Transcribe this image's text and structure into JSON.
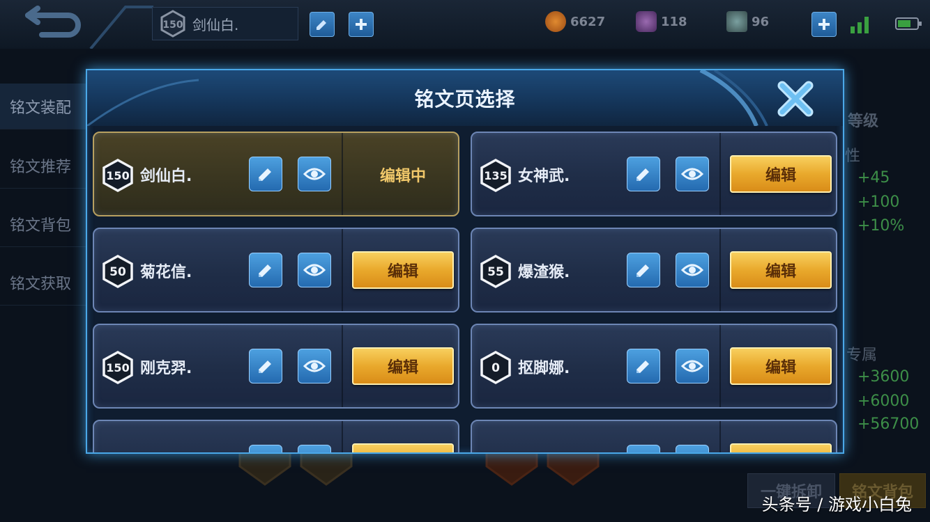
{
  "topbar": {
    "page_level": "150",
    "page_name": "剑仙白.",
    "gold": "6627",
    "diamonds": "118",
    "coupons": "96"
  },
  "side_menu": [
    {
      "label": "铭文装配"
    },
    {
      "label": "铭文推荐"
    },
    {
      "label": "铭文背包"
    },
    {
      "label": "铭文获取"
    }
  ],
  "right_panel": {
    "level_label": "等级",
    "attr_label": "性",
    "attr_values": [
      "+45",
      "+100",
      "+10%"
    ],
    "exclusive_label": "专属",
    "exclusive_values": [
      "+3600",
      "+6000",
      "+56700"
    ]
  },
  "bottom_buttons": {
    "dismantle": "一键拆卸",
    "backpack": "铭文背包"
  },
  "modal": {
    "title": "铭文页选择",
    "editing_label": "编辑中",
    "edit_label": "编辑",
    "pages": [
      {
        "level": "150",
        "name": "剑仙白.",
        "state": "editing"
      },
      {
        "level": "135",
        "name": "女神武.",
        "state": "edit"
      },
      {
        "level": "50",
        "name": "菊花信.",
        "state": "edit"
      },
      {
        "level": "55",
        "name": "爆渣猴.",
        "state": "edit"
      },
      {
        "level": "150",
        "name": "刚克羿.",
        "state": "edit"
      },
      {
        "level": "0",
        "name": "抠脚娜.",
        "state": "edit"
      }
    ]
  },
  "watermark": "头条号 / 游戏小白兔",
  "colors": {
    "accent_blue": "#4aa8e8",
    "edit_button_gold": "#e9a92c",
    "active_card_gold": "#b8a060",
    "stat_green": "#3d8f48"
  }
}
